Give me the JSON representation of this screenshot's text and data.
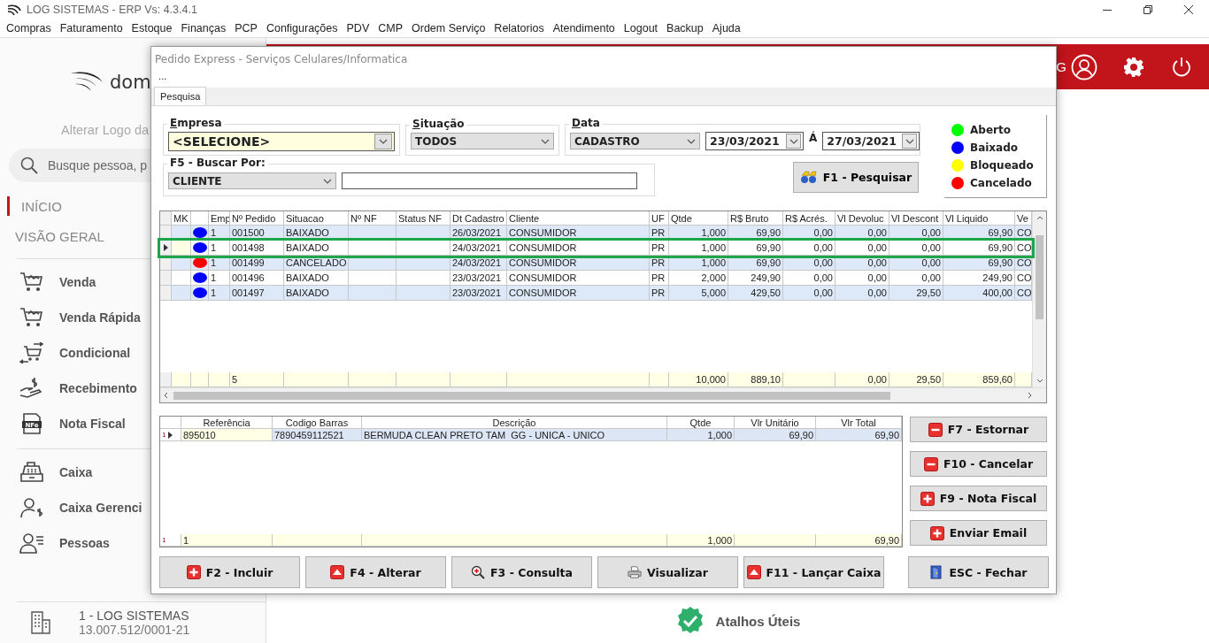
{
  "app": {
    "title": "LOG SISTEMAS - ERP Vs: 4.3.4.1"
  },
  "menu": [
    "Compras",
    "Faturamento",
    "Estoque",
    "Finanças",
    "PCP",
    "Configurações",
    "PDV",
    "CMP",
    "Ordem Serviço",
    "Relatorios",
    "Atendimento",
    "Logout",
    "Backup",
    "Ajuda"
  ],
  "sidebar": {
    "logo": "dom",
    "change_logo": "Alterar Logo da",
    "search": {
      "placeholder": "Busque pessoa, p"
    },
    "sections": [
      {
        "label": "INÍCIO",
        "selected": true
      },
      {
        "label": "VISÃO GERAL",
        "selected": false
      }
    ],
    "primary": [
      {
        "kind": "cart",
        "label": "Venda"
      },
      {
        "kind": "cart",
        "label": "Venda Rápida"
      },
      {
        "kind": "cart-exchange",
        "label": "Condicional"
      },
      {
        "kind": "hand-money",
        "label": "Recebimento"
      },
      {
        "kind": "document",
        "badge": "NFe",
        "label": "Nota Fiscal"
      }
    ],
    "secondary": [
      {
        "kind": "register",
        "label": "Caixa"
      },
      {
        "kind": "person-money",
        "label": "Caixa Gerenci"
      },
      {
        "kind": "person-list",
        "label": "Pessoas"
      }
    ],
    "company": {
      "name": "1 - LOG SISTEMAS",
      "document": "13.007.512/0001-21"
    }
  },
  "header": {
    "user": "G"
  },
  "shortcuts": {
    "label": "Atalhos Úteis"
  },
  "dialog": {
    "title": "Pedido Express - Serviços Celulares/Informatica",
    "menu": "...",
    "tabs": [
      {
        "label": "Pesquisa",
        "selected": true
      }
    ],
    "empresa": {
      "label": "Empresa",
      "value": "<SELECIONE>"
    },
    "situacao": {
      "label": "Situação",
      "value": "TODOS"
    },
    "data": {
      "label": "Data",
      "field": "CADASTRO",
      "from": "23/03/2021",
      "separator": "Á",
      "to": "27/03/2021"
    },
    "buscar": {
      "label": "F5 - Buscar Por:",
      "field": "CLIENTE"
    },
    "search_button": "F1 - Pesquisar",
    "legend": [
      {
        "label": "Aberto",
        "color": "#00ff00"
      },
      {
        "label": "Baixado",
        "color": "#0000ff"
      },
      {
        "label": "Bloqueado",
        "color": "#ffff00"
      },
      {
        "label": "Cancelado",
        "color": "#ff0000"
      }
    ],
    "orders": {
      "columns": [
        {
          "label": "MK",
          "kind": "text"
        },
        {
          "kind": "status"
        },
        {
          "label": "Emp",
          "kind": "text"
        },
        {
          "label": "Nº Pedido",
          "kind": "text",
          "total": "5"
        },
        {
          "label": "Situacao",
          "kind": "text"
        },
        {
          "label": "Nº NF",
          "kind": "text"
        },
        {
          "label": "Status NF",
          "kind": "text"
        },
        {
          "label": "Dt Cadastro",
          "kind": "text"
        },
        {
          "label": "Cliente",
          "kind": "text"
        },
        {
          "label": "UF",
          "kind": "text"
        },
        {
          "label": "Qtde",
          "kind": "number",
          "total": "10,000"
        },
        {
          "label": "R$ Bruto",
          "kind": "number",
          "total": "889,10"
        },
        {
          "label": "R$ Acrés.",
          "kind": "number"
        },
        {
          "label": "Vl Devoluc",
          "kind": "number",
          "total": "0,00"
        },
        {
          "label": "Vl Descont",
          "kind": "number",
          "total": "29,50"
        },
        {
          "label": "Vl Liquido",
          "kind": "number",
          "total": "859,60"
        },
        {
          "label": "Ve",
          "kind": "text"
        }
      ],
      "rows": [
        {
          "selected": false,
          "color": "#0000ff",
          "cells": [
            null,
            null,
            "1",
            "001500",
            "BAIXADO",
            null,
            null,
            "26/03/2021",
            "CONSUMIDOR",
            "PR",
            "1,000",
            "69,90",
            "0,00",
            "0,00",
            "0,00",
            "69,90",
            "CO"
          ]
        },
        {
          "selected": true,
          "color": "#0000ff",
          "cells": [
            null,
            null,
            "1",
            "001498",
            "BAIXADO",
            null,
            null,
            "24/03/2021",
            "CONSUMIDOR",
            "PR",
            "1,000",
            "69,90",
            "0,00",
            "0,00",
            "0,00",
            "69,90",
            "CO"
          ]
        },
        {
          "selected": false,
          "color": "#ff0000",
          "cells": [
            null,
            null,
            "1",
            "001499",
            "CANCELADO",
            null,
            null,
            "24/03/2021",
            "CONSUMIDOR",
            "PR",
            "1,000",
            "69,90",
            "0,00",
            "0,00",
            "0,00",
            "69,90",
            "CO"
          ]
        },
        {
          "selected": false,
          "color": "#0000ff",
          "cells": [
            null,
            null,
            "1",
            "001496",
            "BAIXADO",
            null,
            null,
            "23/03/2021",
            "CONSUMIDOR",
            "PR",
            "2,000",
            "249,90",
            "0,00",
            "0,00",
            "0,00",
            "249,90",
            "CO"
          ]
        },
        {
          "selected": false,
          "color": "#0000ff",
          "cells": [
            null,
            null,
            "1",
            "001497",
            "BAIXADO",
            null,
            null,
            "23/03/2021",
            "CONSUMIDOR",
            "PR",
            "5,000",
            "429,50",
            "0,00",
            "0,00",
            "29,50",
            "400,00",
            "CO"
          ]
        }
      ],
      "totals": {
        "kind": "summary"
      }
    },
    "items": {
      "columns": [
        {
          "label": "Referência",
          "kind": "text"
        },
        {
          "label": "Codigo Barras",
          "kind": "text"
        },
        {
          "label": "Descrição",
          "kind": "text"
        },
        {
          "label": "Qtde",
          "kind": "number"
        },
        {
          "label": "Vlr Unitário",
          "kind": "number"
        },
        {
          "label": "Vlr Total",
          "kind": "number"
        }
      ],
      "rows": [
        {
          "number": "1",
          "selected": true,
          "cells": [
            "895010",
            "7890459112521",
            "BERMUDA CLEAN PRETO TAM  GG - UNICA - UNICO",
            "1,000",
            "69,90",
            "69,90"
          ]
        }
      ],
      "totals": {
        "number": "1",
        "item_count": "1",
        "quantity": "1,000",
        "amount": "69,90"
      }
    },
    "side_buttons": [
      {
        "label": "F7 - Estornar",
        "kind": "minus"
      },
      {
        "label": "F10 - Cancelar",
        "kind": "minus"
      },
      {
        "label": "F9 - Nota Fiscal",
        "kind": "plus"
      },
      {
        "label": "Enviar Email",
        "kind": "plus"
      }
    ],
    "buttons": [
      {
        "label": "F2 - Incluir",
        "kind": "plus"
      },
      {
        "label": "F4 - Alterar",
        "kind": "up"
      },
      {
        "label": "F3 - Consulta",
        "kind": "zoom"
      },
      {
        "label": "Visualizar",
        "kind": "printer"
      },
      {
        "label": "F11 - Lançar Caixa",
        "kind": "up"
      },
      {
        "label": "ESC - Fechar",
        "kind": "door"
      }
    ]
  }
}
